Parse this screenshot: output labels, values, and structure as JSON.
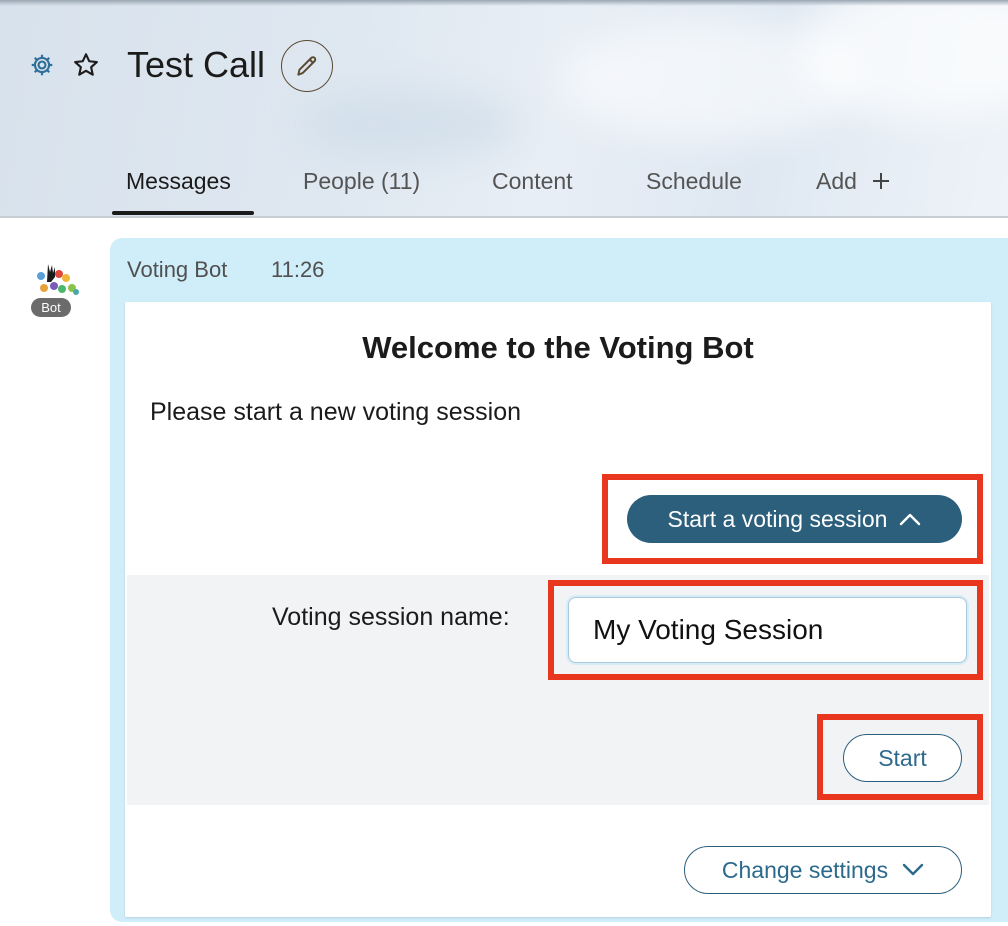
{
  "header": {
    "title": "Test Call",
    "icons": {
      "settings": "gear-icon",
      "favorite": "star-icon",
      "edit": "pencil-icon"
    }
  },
  "tabs": [
    {
      "label": "Messages",
      "active": true
    },
    {
      "label": "People (11)",
      "active": false
    },
    {
      "label": "Content",
      "active": false
    },
    {
      "label": "Schedule",
      "active": false
    },
    {
      "label": "Add",
      "active": false,
      "icon": "plus-icon"
    }
  ],
  "message": {
    "sender": "Voting Bot",
    "time": "11:26",
    "badge": "Bot",
    "bubble_color": "#cfeefa",
    "card": {
      "title": "Welcome to the Voting Bot",
      "text": "Please start a new voting session",
      "start_session_button": "Start a voting session",
      "field_label": "Voting session name:",
      "field_value": "My Voting Session",
      "start_button": "Start",
      "change_settings_button": "Change settings"
    }
  },
  "colors": {
    "primary_button": "#2c5f7c",
    "highlight": "#e8361f"
  }
}
